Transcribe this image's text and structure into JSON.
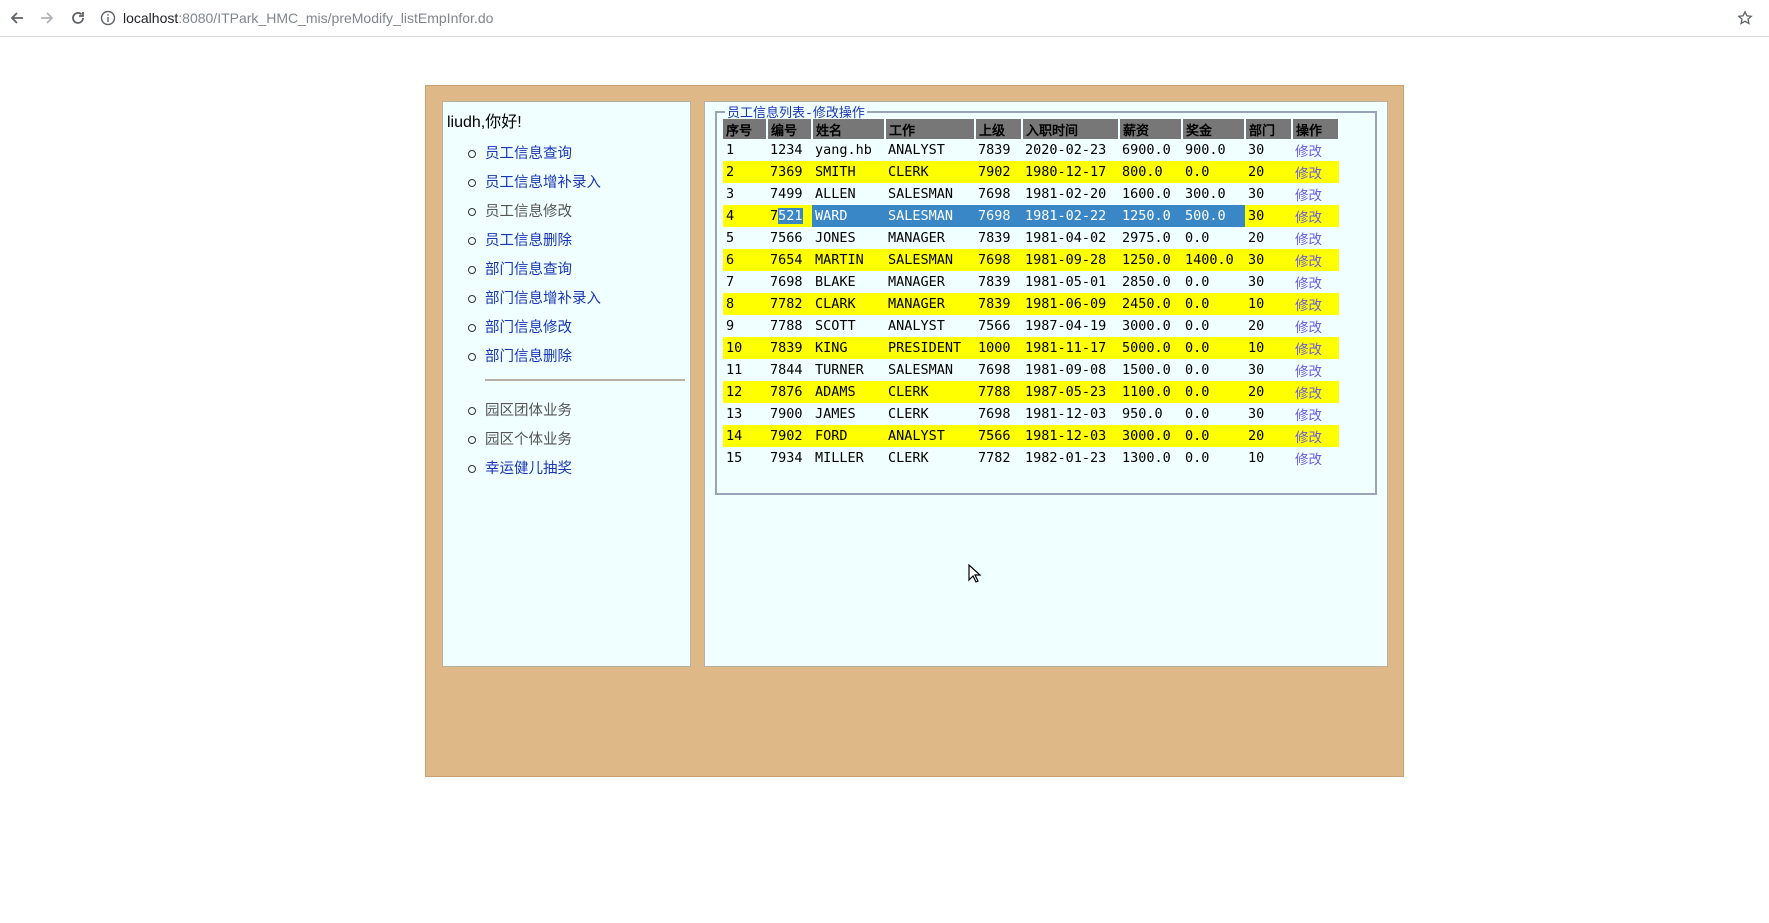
{
  "browser": {
    "url_host": "localhost",
    "url_path": ":8080/ITPark_HMC_mis/preModify_listEmpInfor.do"
  },
  "sidebar": {
    "greeting": "liudh,你好!",
    "menu1": [
      "员工信息查询",
      "员工信息增补录入",
      "员工信息修改",
      "员工信息删除",
      "部门信息查询",
      "部门信息增补录入",
      "部门信息修改",
      "部门信息删除"
    ],
    "menu2": [
      "园区团体业务",
      "园区个体业务",
      "幸运健儿抽奖"
    ]
  },
  "panel": {
    "legend": "员工信息列表-修改操作",
    "headers": [
      "序号",
      "编号",
      "姓名",
      "工作",
      "上级",
      "入职时间",
      "薪资",
      "奖金",
      "部门",
      "操作"
    ],
    "rows": [
      [
        "1",
        "1234",
        "yang.hb",
        "ANALYST",
        "7839",
        "2020-02-23",
        "6900.0",
        "900.0",
        "30",
        "修改"
      ],
      [
        "2",
        "7369",
        "SMITH",
        "CLERK",
        "7902",
        "1980-12-17",
        "800.0",
        "0.0",
        "20",
        "修改"
      ],
      [
        "3",
        "7499",
        "ALLEN",
        "SALESMAN",
        "7698",
        "1981-02-20",
        "1600.0",
        "300.0",
        "30",
        "修改"
      ],
      [
        "4",
        "7521",
        "WARD",
        "SALESMAN",
        "7698",
        "1981-02-22",
        "1250.0",
        "500.0",
        "30",
        "修改"
      ],
      [
        "5",
        "7566",
        "JONES",
        "MANAGER",
        "7839",
        "1981-04-02",
        "2975.0",
        "0.0",
        "20",
        "修改"
      ],
      [
        "6",
        "7654",
        "MARTIN",
        "SALESMAN",
        "7698",
        "1981-09-28",
        "1250.0",
        "1400.0",
        "30",
        "修改"
      ],
      [
        "7",
        "7698",
        "BLAKE",
        "MANAGER",
        "7839",
        "1981-05-01",
        "2850.0",
        "0.0",
        "30",
        "修改"
      ],
      [
        "8",
        "7782",
        "CLARK",
        "MANAGER",
        "7839",
        "1981-06-09",
        "2450.0",
        "0.0",
        "10",
        "修改"
      ],
      [
        "9",
        "7788",
        "SCOTT",
        "ANALYST",
        "7566",
        "1987-04-19",
        "3000.0",
        "0.0",
        "20",
        "修改"
      ],
      [
        "10",
        "7839",
        "KING",
        "PRESIDENT",
        "1000",
        "1981-11-17",
        "5000.0",
        "0.0",
        "10",
        "修改"
      ],
      [
        "11",
        "7844",
        "TURNER",
        "SALESMAN",
        "7698",
        "1981-09-08",
        "1500.0",
        "0.0",
        "30",
        "修改"
      ],
      [
        "12",
        "7876",
        "ADAMS",
        "CLERK",
        "7788",
        "1987-05-23",
        "1100.0",
        "0.0",
        "20",
        "修改"
      ],
      [
        "13",
        "7900",
        "JAMES",
        "CLERK",
        "7698",
        "1981-12-03",
        "950.0",
        "0.0",
        "30",
        "修改"
      ],
      [
        "14",
        "7902",
        "FORD",
        "ANALYST",
        "7566",
        "1981-12-03",
        "3000.0",
        "0.0",
        "20",
        "修改"
      ],
      [
        "15",
        "7934",
        "MILLER",
        "CLERK",
        "7782",
        "1982-01-23",
        "1300.0",
        "0.0",
        "10",
        "修改"
      ]
    ]
  },
  "colors": {
    "frame": "#deb887",
    "panel": "#f0ffff",
    "highlight_row": "#ffff00",
    "selection": "#3a87c8",
    "header": "#777777",
    "link": "#1a35b5"
  }
}
